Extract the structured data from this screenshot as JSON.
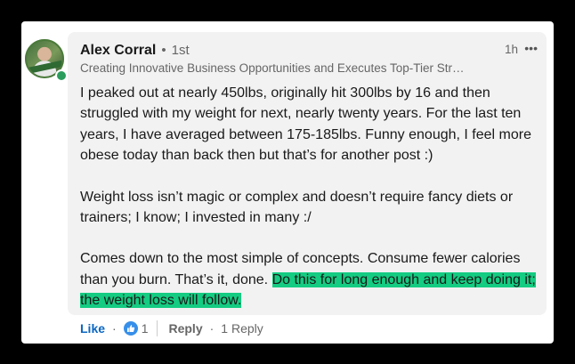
{
  "comment": {
    "author": "Alex Corral",
    "degree_separator": "•",
    "degree": "1st",
    "headline": "Creating Innovative Business Opportunities and Executes Top-Tier Str…",
    "timestamp": "1h",
    "more_icon": "more-horizontal-icon",
    "more_label": "•••",
    "paragraphs": {
      "p1": "I peaked out at nearly 450lbs, originally hit 300lbs by 16 and then struggled with my weight for next, nearly twenty years. For the last ten years, I have averaged between 175-185lbs. Funny enough, I feel more obese today than back then but that’s for another post :)",
      "p2": "Weight loss isn’t magic or complex and doesn’t require fancy diets or trainers; I know; I invested in many :/",
      "p3_plain": "Comes down to the most simple of concepts. Consume fewer calories than you burn. That’s it, done. ",
      "p3_highlight": "Do this for long enough and keep doing it; the weight loss will follow."
    },
    "highlight_color": "#14cc82"
  },
  "actions": {
    "like_label": "Like",
    "dot": "·",
    "reaction_icon": "thumbs-up-icon",
    "reaction_count": "1",
    "reply_label": "Reply",
    "dot2": "·",
    "reply_count_label": "1 Reply"
  },
  "colors": {
    "link_blue": "#0a66c2",
    "reaction_blue": "#378fe9",
    "presence_green": "#2a9d5c"
  }
}
